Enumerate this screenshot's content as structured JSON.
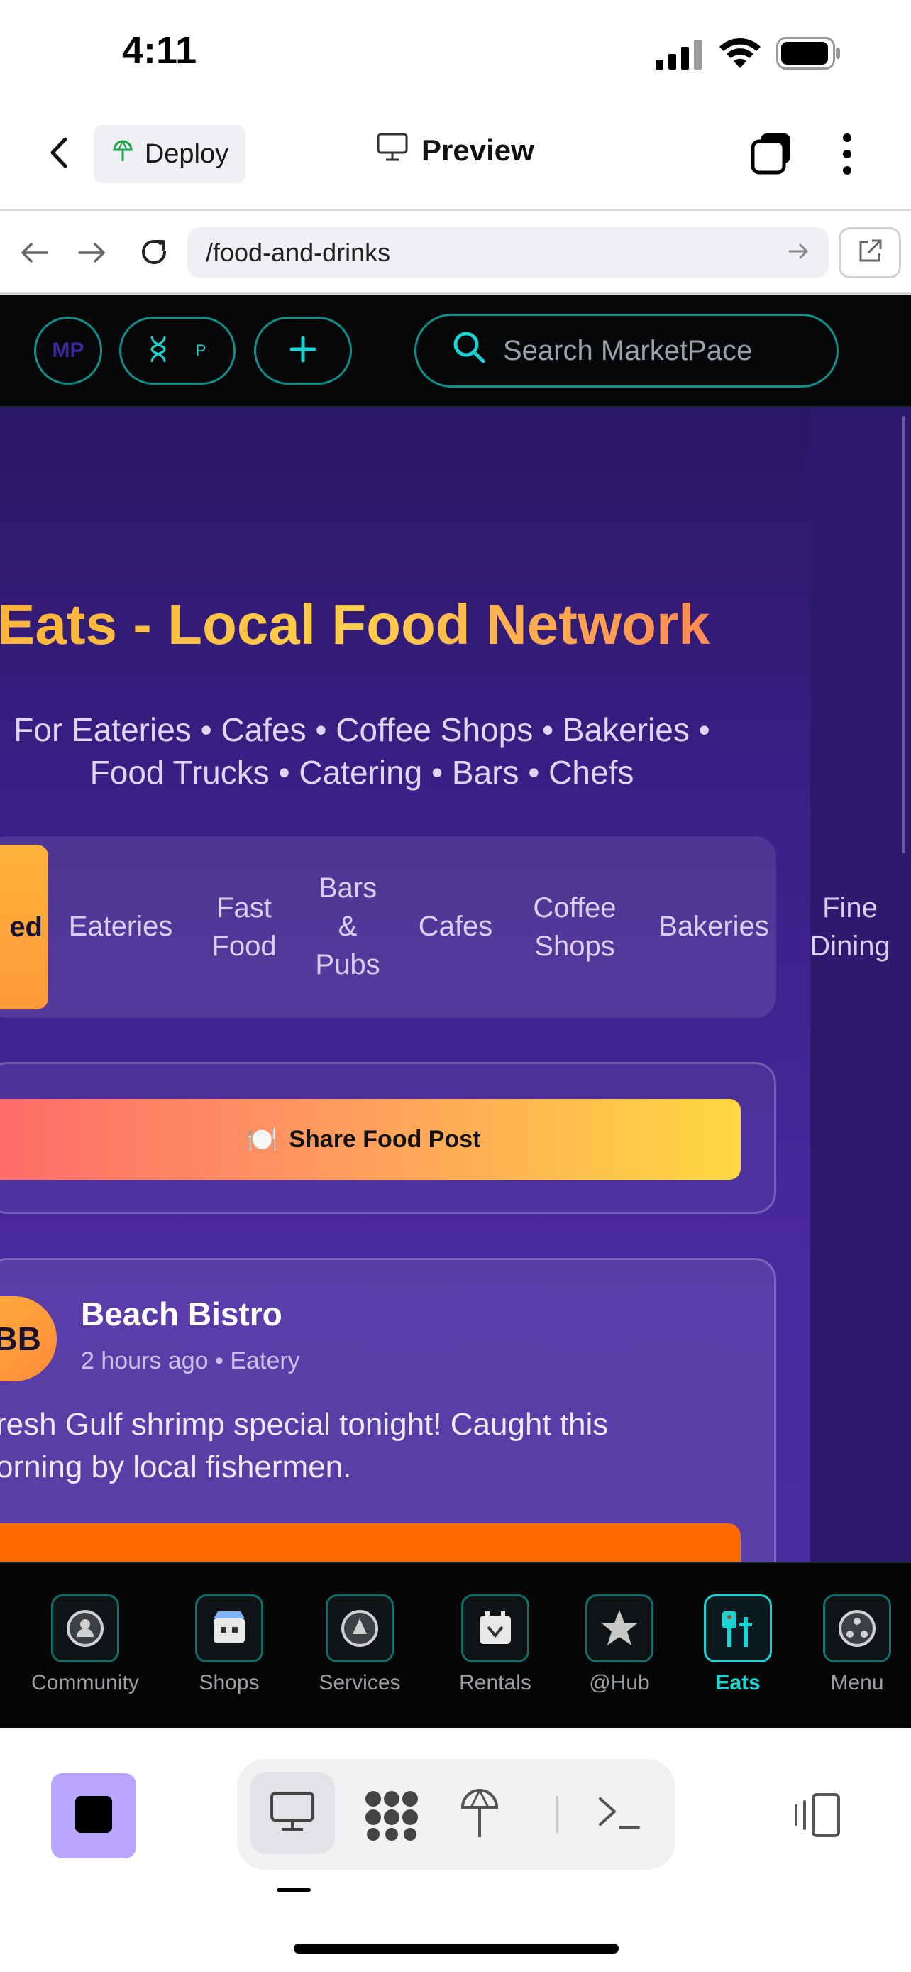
{
  "status_bar": {
    "time": "4:11"
  },
  "replit_header": {
    "deploy_label": "Deploy",
    "preview_label": "Preview"
  },
  "browser": {
    "url": "/food-and-drinks"
  },
  "top_nav": {
    "logo_text": "MP",
    "profile_letter": "P",
    "search_placeholder": "Search MarketPace"
  },
  "hero": {
    "title": "Eats - Local Food Network",
    "subtitle_line1": "For Eateries • Cafes • Coffee Shops • Bakeries •",
    "subtitle_line2": "Food Trucks • Catering • Bars • Chefs"
  },
  "categories": [
    {
      "label": "ed",
      "active": true
    },
    {
      "label": "Eateries"
    },
    {
      "label": "Fast Food"
    },
    {
      "label": "Bars & Pubs"
    },
    {
      "label": "Cafes"
    },
    {
      "label": "Coffee Shops"
    },
    {
      "label": "Bakeries"
    },
    {
      "label": "Fine Dining"
    }
  ],
  "share_button": {
    "icon": "🍽️",
    "label": "Share Food Post"
  },
  "post": {
    "initials": "BB",
    "author": "Beach Bistro",
    "meta": "2 hours ago • Eatery",
    "text_line1": "resh Gulf shrimp special tonight! Caught this",
    "text_line2": "orning by local fishermen."
  },
  "bottom_nav": [
    {
      "label": "Community",
      "icon": "community-icon"
    },
    {
      "label": "Shops",
      "icon": "shops-icon"
    },
    {
      "label": "Services",
      "icon": "services-icon"
    },
    {
      "label": "Rentals",
      "icon": "rentals-icon"
    },
    {
      "label": "@Hub",
      "icon": "star-icon"
    },
    {
      "label": "Eats",
      "icon": "eats-icon",
      "active": true
    },
    {
      "label": "Menu",
      "icon": "menu-icon"
    }
  ],
  "colors": {
    "accent_teal": "#12d6d6",
    "title_gold": "#ffc23a",
    "stop_purple": "#b9a7ff"
  }
}
